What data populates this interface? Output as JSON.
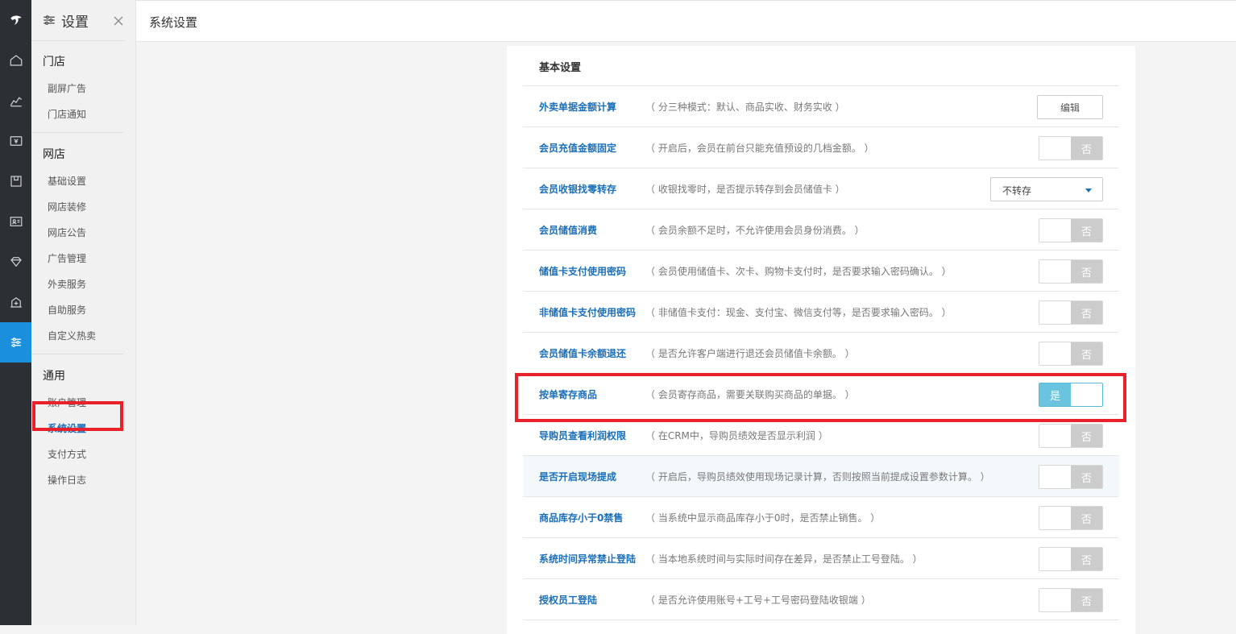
{
  "topbar": {
    "page_title": "系统设置"
  },
  "menu": {
    "title": "设置",
    "groups": [
      {
        "title": "门店",
        "items": [
          "副屏广告",
          "门店通知"
        ]
      },
      {
        "title": "网店",
        "items": [
          "基础设置",
          "网店装修",
          "网店公告",
          "广告管理",
          "外卖服务",
          "自助服务",
          "自定义热卖"
        ]
      },
      {
        "title": "通用",
        "items": [
          "账户管理",
          "系统设置",
          "支付方式",
          "操作日志"
        ]
      }
    ]
  },
  "card": {
    "title": "基本设置",
    "rows": [
      {
        "label": "外卖单据金额计算",
        "desc": "（ 分三种模式：默认、商品实收、财务实收 ）",
        "control": "button",
        "value": "编辑"
      },
      {
        "label": "会员充值金额固定",
        "desc": "（ 开启后，会员在前台只能充值预设的几档金额。 ）",
        "control": "toggle",
        "value": "否"
      },
      {
        "label": "会员收银找零转存",
        "desc": "（ 收银找零时，是否提示转存到会员储值卡 ）",
        "control": "select",
        "value": "不转存"
      },
      {
        "label": "会员储值消费",
        "desc": "（ 会员余额不足时，不允许使用会员身份消费。 ）",
        "control": "toggle",
        "value": "否"
      },
      {
        "label": "储值卡支付使用密码",
        "desc": "（ 会员使用储值卡、次卡、购物卡支付时，是否要求输入密码确认。 ）",
        "control": "toggle",
        "value": "否"
      },
      {
        "label": "非储值卡支付使用密码",
        "desc": "（ 非储值卡支付：现金、支付宝、微信支付等，是否要求输入密码。 ）",
        "control": "toggle",
        "value": "否"
      },
      {
        "label": "会员储值卡余额退还",
        "desc": "（ 是否允许客户端进行退还会员储值卡余额。 ）",
        "control": "toggle",
        "value": "否"
      },
      {
        "label": "按单寄存商品",
        "desc": "（ 会员寄存商品，需要关联购买商品的单据。 ）",
        "control": "toggle",
        "value": "是"
      },
      {
        "label": "导购员查看利润权限",
        "desc": "（ 在CRM中，导购员绩效是否显示利润 ）",
        "control": "toggle",
        "value": "否"
      },
      {
        "label": "是否开启现场提成",
        "desc": "（ 开启后，导购员绩效使用现场记录计算，否则按照当前提成设置参数计算。 ）",
        "control": "toggle",
        "value": "否"
      },
      {
        "label": "商品库存小于0禁售",
        "desc": "（ 当系统中显示商品库存小于0时，是否禁止销售。 ）",
        "control": "toggle",
        "value": "否"
      },
      {
        "label": "系统时间异常禁止登陆",
        "desc": "（ 当本地系统时间与实际时间存在差异，是否禁止工号登陆。 ）",
        "control": "toggle",
        "value": "否"
      },
      {
        "label": "授权员工登陆",
        "desc": "（ 是否允许使用账号+工号+工号密码登陆收银端 ）",
        "control": "toggle",
        "value": "否"
      }
    ]
  },
  "colors": {
    "accent": "#1a6fb8",
    "rail": "#2c2f33",
    "rail_active": "#1a8fdc",
    "toggle_on": "#6ac4e0",
    "highlight": "#e8212b"
  }
}
